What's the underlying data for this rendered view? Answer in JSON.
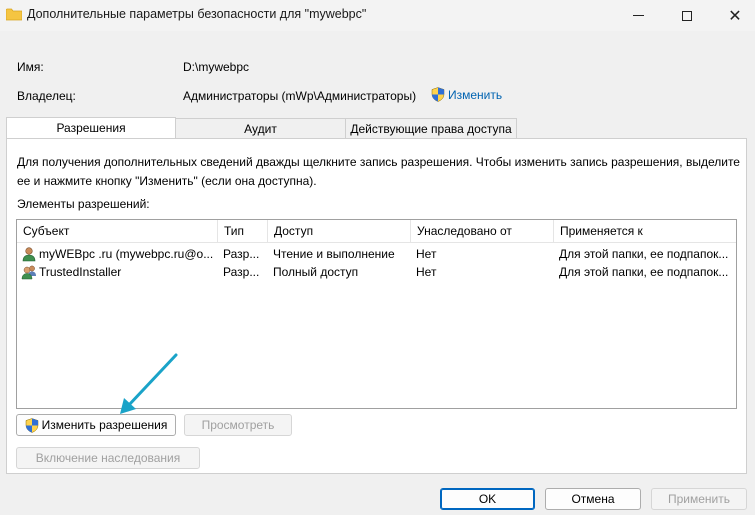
{
  "window": {
    "title": "Дополнительные параметры безопасности  для \"mywebpc\""
  },
  "fields": {
    "name_label": "Имя:",
    "name_value": "D:\\mywebpc",
    "owner_label": "Владелец:",
    "owner_value": "Администраторы (mWp\\Администраторы)",
    "change_owner_link": "Изменить"
  },
  "tabs": [
    {
      "label": "Разрешения",
      "active": true
    },
    {
      "label": "Аудит",
      "active": false
    },
    {
      "label": "Действующие права доступа",
      "active": false
    }
  ],
  "panel": {
    "info_text": "Для получения дополнительных сведений дважды щелкните запись разрешения. Чтобы изменить запись разрешения, выделите ее и нажмите кнопку \"Изменить\" (если она доступна).",
    "entries_label": "Элементы разрешений:",
    "columns": [
      "Субъект",
      "Тип",
      "Доступ",
      "Унаследовано от",
      "Применяется к"
    ],
    "rows": [
      {
        "subject": "myWEBpc .ru (mywebpc.ru@o...",
        "type": "Разр...",
        "access": "Чтение и выполнение",
        "inherited": "Нет",
        "applies": "Для этой папки, ее подпапок..."
      },
      {
        "subject": "TrustedInstaller",
        "type": "Разр...",
        "access": "Полный доступ",
        "inherited": "Нет",
        "applies": "Для этой папки, ее подпапок..."
      }
    ],
    "change_permissions_button": "Изменить разрешения",
    "view_button": "Просмотреть",
    "enable_inheritance_button": "Включение наследования"
  },
  "footer": {
    "ok": "OK",
    "cancel": "Отмена",
    "apply": "Применить"
  },
  "colors": {
    "link": "#0063b1",
    "annotation_arrow": "#1aa3c8"
  }
}
